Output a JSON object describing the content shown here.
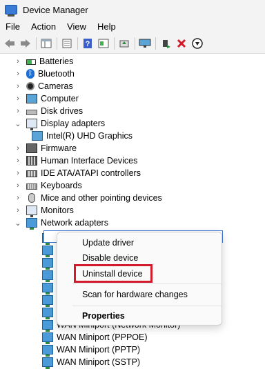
{
  "window": {
    "title": "Device Manager"
  },
  "menu": [
    "File",
    "Action",
    "View",
    "Help"
  ],
  "toolbar": {
    "buttons": [
      "back-icon",
      "forward-icon",
      "show-hide-tree-icon",
      "properties-icon",
      "help-icon",
      "refresh-view-icon",
      "update-driver-icon",
      "scan-hardware-icon",
      "enable-device-icon",
      "uninstall-icon",
      "disable-device-icon"
    ],
    "accent_red": "#d11a2a",
    "accent_green": "#2d8a3e"
  },
  "tree": {
    "categories": [
      {
        "label": "Batteries",
        "icon": "battery-icon",
        "expanded": false
      },
      {
        "label": "Bluetooth",
        "icon": "bluetooth-icon",
        "expanded": false
      },
      {
        "label": "Cameras",
        "icon": "camera-icon",
        "expanded": false
      },
      {
        "label": "Computer",
        "icon": "computer-icon",
        "expanded": false
      },
      {
        "label": "Disk drives",
        "icon": "disk-icon",
        "expanded": false
      },
      {
        "label": "Display adapters",
        "icon": "display-adapter-icon",
        "expanded": true
      },
      {
        "label": "Intel(R) UHD Graphics",
        "icon": "gpu-icon",
        "child": true
      },
      {
        "label": "Firmware",
        "icon": "firmware-icon",
        "expanded": false
      },
      {
        "label": "Human Interface Devices",
        "icon": "hid-icon",
        "expanded": false
      },
      {
        "label": "IDE ATA/ATAPI controllers",
        "icon": "ide-icon",
        "expanded": false
      },
      {
        "label": "Keyboards",
        "icon": "keyboard-icon",
        "expanded": false
      },
      {
        "label": "Mice and other pointing devices",
        "icon": "mouse-icon",
        "expanded": false
      },
      {
        "label": "Monitors",
        "icon": "monitor-icon",
        "expanded": false
      },
      {
        "label": "Network adapters",
        "icon": "network-icon",
        "expanded": true
      }
    ],
    "network_children": [
      {
        "label": "WAN Miniport (Network Monitor)"
      },
      {
        "label": "WAN Miniport (PPPOE)"
      },
      {
        "label": "WAN Miniport (PPTP)"
      },
      {
        "label": "WAN Miniport (SSTP)"
      }
    ]
  },
  "context_menu": {
    "items": [
      "Update driver",
      "Disable device",
      "Uninstall device",
      "Scan for hardware changes",
      "Properties"
    ],
    "highlighted": "Uninstall device"
  }
}
